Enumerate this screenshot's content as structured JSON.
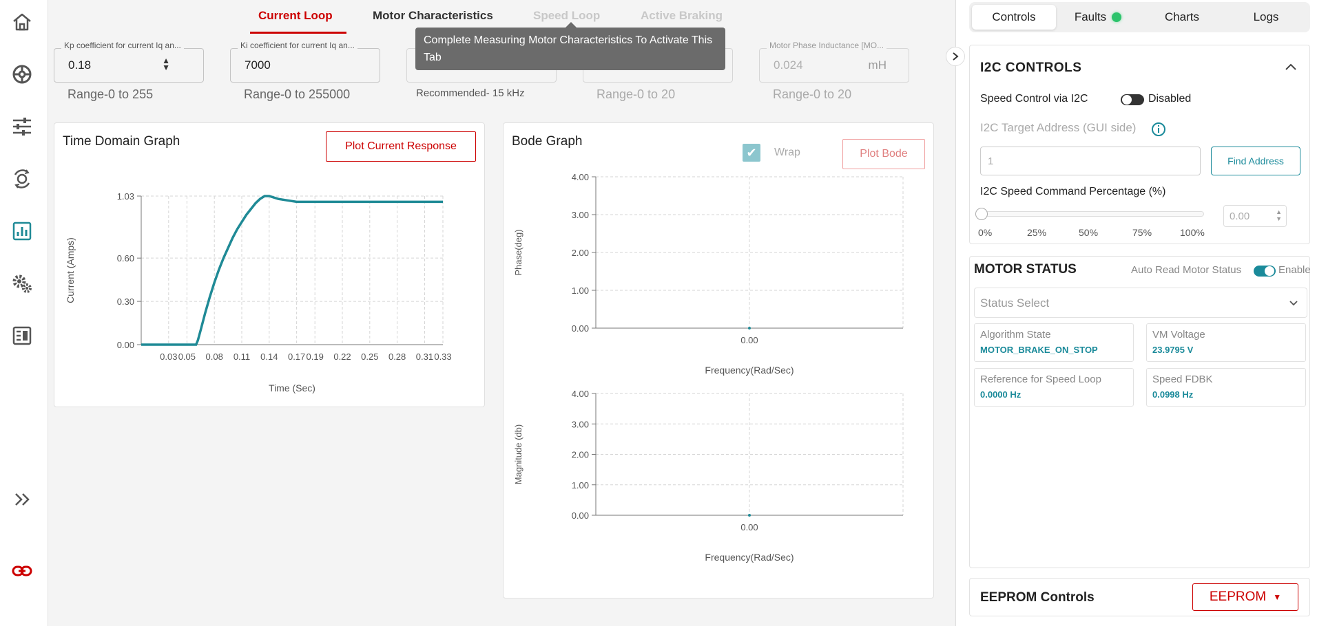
{
  "nav": {
    "icons": [
      "home-icon",
      "dashboard-icon",
      "tune-sliders-icon",
      "motor-rotation-icon",
      "bar-chart-icon",
      "settings-gears-icon",
      "report-table-icon",
      "expand-double-chevron-icon",
      "link-icon"
    ]
  },
  "tabs": {
    "current_loop": "Current Loop",
    "motor_characteristics": "Motor Characteristics",
    "speed_loop": "Speed Loop",
    "active_braking": "Active Braking"
  },
  "tooltip": "Complete Measuring Motor Characteristics To Activate This Tab",
  "params": {
    "kp": {
      "label": "Kp coefficient for current Iq an...",
      "value": "0.18",
      "range": "Range-0 to 255"
    },
    "ki": {
      "label": "Ki coefficient for current Iq an...",
      "value": "7000",
      "range": "Range-0 to 255000"
    },
    "pwm": {
      "label": "",
      "value": "",
      "recommend": "Recommended- 15 kHz"
    },
    "resistance": {
      "label": "",
      "value": "0.45",
      "unit": "Ohm",
      "range": "Range-0 to 20"
    },
    "inductance": {
      "label": "Motor Phase Inductance [MO...",
      "value": "0.024",
      "unit": "mH",
      "range": "Range-0 to 20"
    }
  },
  "time_graph": {
    "title": "Time Domain Graph",
    "button": "Plot Current Response"
  },
  "bode_graph": {
    "title": "Bode Graph",
    "wrap_label": "Wrap",
    "button": "Plot Bode"
  },
  "chart_data": [
    {
      "type": "line",
      "title": "Time Domain Graph",
      "xlabel": "Time (Sec)",
      "ylabel": "Current (Amps)",
      "x_ticks": [
        "0.03",
        "0.05",
        "0.08",
        "0.11",
        "0.14",
        "0.17",
        "0.19",
        "0.22",
        "0.25",
        "0.28",
        "0.31",
        "0.33"
      ],
      "y_ticks": [
        "0.00",
        "0.30",
        "0.60",
        "1.03"
      ],
      "xlim": [
        0,
        0.33
      ],
      "ylim": [
        0,
        1.03
      ],
      "color": "#1f8a96",
      "x": [
        0.0,
        0.02,
        0.04,
        0.06,
        0.062,
        0.065,
        0.07,
        0.075,
        0.08,
        0.085,
        0.09,
        0.095,
        0.1,
        0.105,
        0.11,
        0.115,
        0.12,
        0.125,
        0.13,
        0.135,
        0.14,
        0.15,
        0.16,
        0.17,
        0.19,
        0.22,
        0.25,
        0.28,
        0.31,
        0.33
      ],
      "y": [
        0.0,
        0.0,
        0.0,
        0.0,
        0.03,
        0.1,
        0.22,
        0.33,
        0.43,
        0.52,
        0.6,
        0.67,
        0.74,
        0.8,
        0.85,
        0.9,
        0.94,
        0.98,
        1.01,
        1.03,
        1.03,
        1.01,
        1.0,
        0.99,
        0.99,
        0.99,
        0.99,
        0.99,
        0.99,
        0.99
      ]
    },
    {
      "type": "line",
      "title": "",
      "xlabel": "Frequency(Rad/Sec)",
      "ylabel": "Phase(deg)",
      "x_ticks": [
        "0.00"
      ],
      "y_ticks": [
        "0.00",
        "1.00",
        "2.00",
        "3.00",
        "4.00"
      ],
      "ylim": [
        0,
        4
      ],
      "x": [
        0.0
      ],
      "y": [
        0.0
      ]
    },
    {
      "type": "line",
      "title": "",
      "xlabel": "Frequency(Rad/Sec)",
      "ylabel": "Magnitude (db)",
      "x_ticks": [
        "0.00"
      ],
      "y_ticks": [
        "0.00",
        "1.00",
        "2.00",
        "3.00",
        "4.00"
      ],
      "ylim": [
        0,
        4
      ],
      "x": [
        0.0
      ],
      "y": [
        0.0
      ]
    }
  ],
  "right": {
    "tabs": {
      "controls": "Controls",
      "faults": "Faults",
      "charts": "Charts",
      "logs": "Logs"
    },
    "i2c": {
      "title": "I2C CONTROLS",
      "speed_control_label": "Speed Control via I2C",
      "speed_control_state": "Disabled",
      "target_label": "I2C Target Address (GUI side)",
      "target_value": "1",
      "find_button": "Find Address",
      "speed_cmd_label": "I2C Speed Command Percentage (%)",
      "slider_ticks": [
        "0%",
        "25%",
        "50%",
        "75%",
        "100%"
      ],
      "slider_value_pct": 0,
      "speed_cmd_value": "0.00"
    },
    "motor_status": {
      "title": "MOTOR STATUS",
      "auto_label": "Auto Read Motor Status",
      "auto_state": "Enable",
      "select_placeholder": "Status Select",
      "cells": [
        {
          "label": "Algorithm State",
          "value": "MOTOR_BRAKE_ON_STOP"
        },
        {
          "label": "VM Voltage",
          "value": "23.9795 V"
        },
        {
          "label": "Reference for Speed Loop",
          "value": "0.0000 Hz"
        },
        {
          "label": "Speed FDBK",
          "value": "0.0998 Hz"
        }
      ]
    },
    "eeprom": {
      "title": "EEPROM Controls",
      "button": "EEPROM"
    }
  },
  "colors": {
    "accent": "#cc0000",
    "teal": "#1f8a96",
    "fault_ok": "#2cc36b"
  }
}
